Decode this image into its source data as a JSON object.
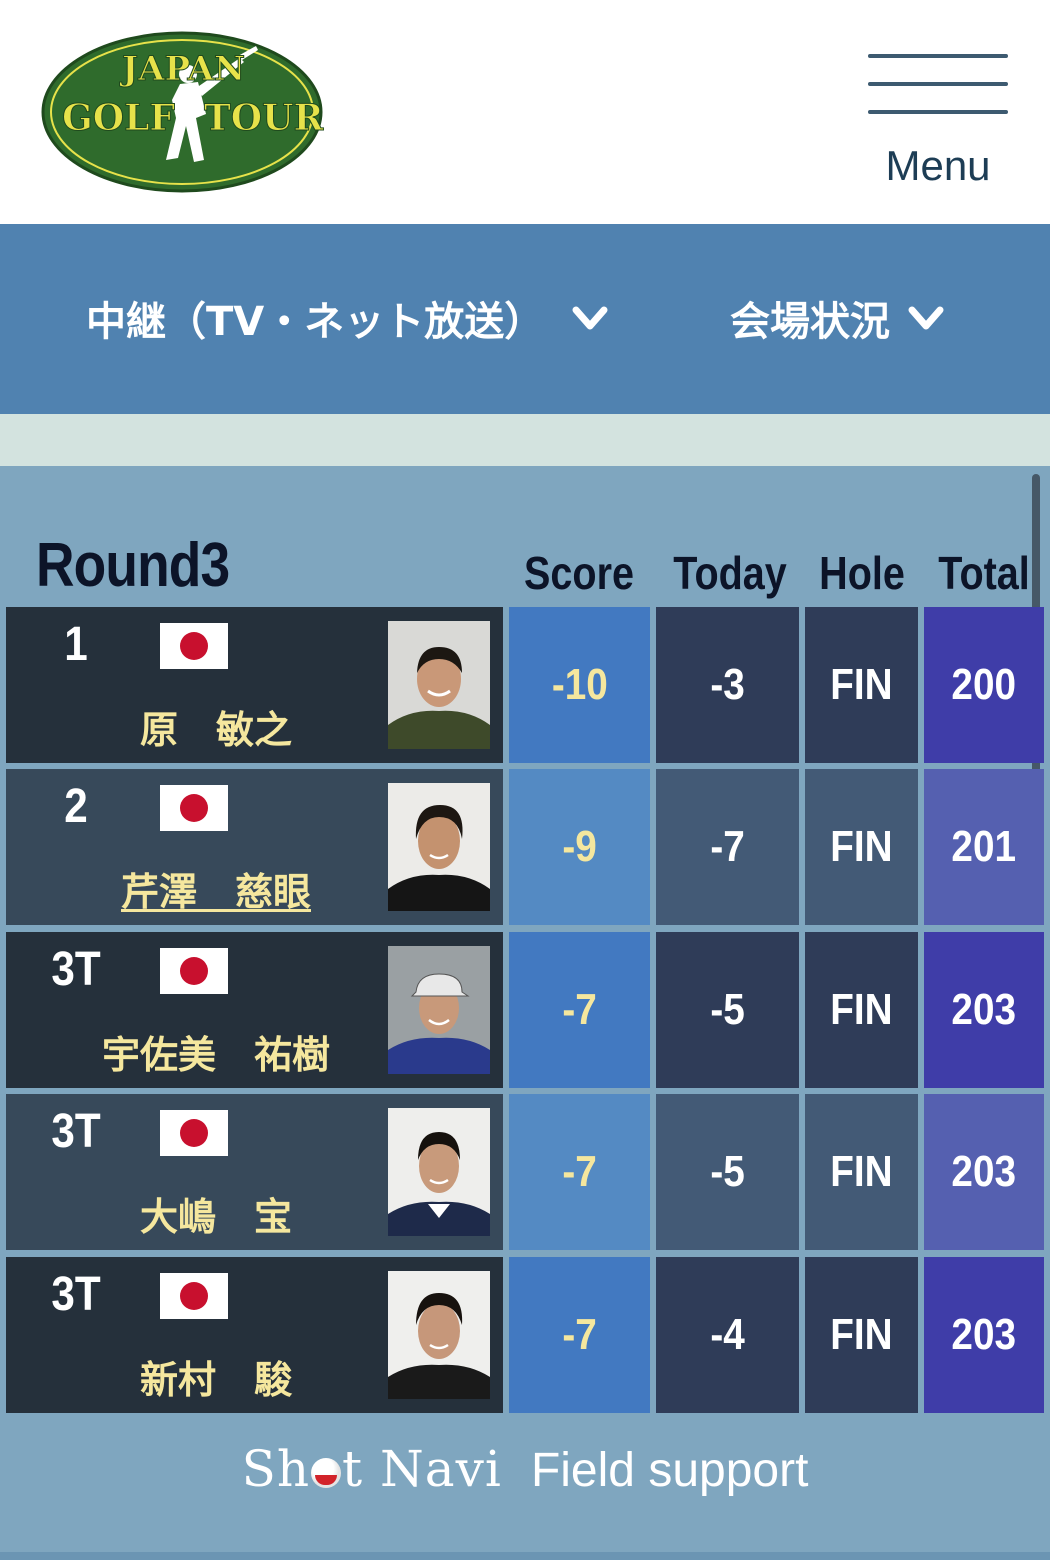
{
  "header": {
    "logo_text": "JAPAN GOLF TOUR",
    "menu_label": "Menu"
  },
  "nav": {
    "broadcast_label": "中継（TV・ネット放送）",
    "venue_label": "会場状況"
  },
  "leaderboard": {
    "round_title": "Round3",
    "columns": {
      "score": "Score",
      "today": "Today",
      "hole": "Hole",
      "total": "Total"
    },
    "rows": [
      {
        "rank": "1",
        "name": "原　敏之",
        "score": "-10",
        "today": "-3",
        "hole": "FIN",
        "total": "200"
      },
      {
        "rank": "2",
        "name": "芹澤　慈眼",
        "score": "-9",
        "today": "-7",
        "hole": "FIN",
        "total": "201"
      },
      {
        "rank": "3T",
        "name": "宇佐美　祐樹",
        "score": "-7",
        "today": "-5",
        "hole": "FIN",
        "total": "203"
      },
      {
        "rank": "3T",
        "name": "大嶋　宝",
        "score": "-7",
        "today": "-5",
        "hole": "FIN",
        "total": "203"
      },
      {
        "rank": "3T",
        "name": "新村　駿",
        "score": "-7",
        "today": "-4",
        "hole": "FIN",
        "total": "203"
      }
    ]
  },
  "footer": {
    "brand_a": "Sh",
    "brand_b": "t Navi",
    "tagline": "Field support"
  },
  "colors": {
    "logo_green": "#2f6b2c",
    "logo_gold": "#e7e24a",
    "nav_blue": "#5082b0",
    "score_text": "#f5e79e",
    "flag_red": "#c8102e"
  }
}
